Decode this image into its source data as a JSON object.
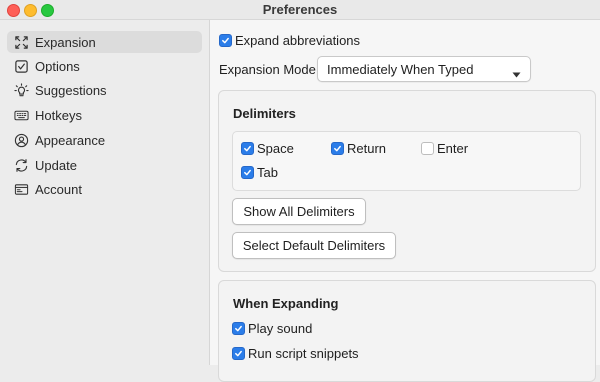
{
  "window": {
    "title": "Preferences"
  },
  "sidebar": {
    "items": [
      {
        "label": "Expansion",
        "icon": "expand-arrows-icon",
        "selected": true
      },
      {
        "label": "Options",
        "icon": "checkbox-icon",
        "selected": false
      },
      {
        "label": "Suggestions",
        "icon": "lightbulb-icon",
        "selected": false
      },
      {
        "label": "Hotkeys",
        "icon": "keyboard-icon",
        "selected": false
      },
      {
        "label": "Appearance",
        "icon": "person-circle-icon",
        "selected": false
      },
      {
        "label": "Update",
        "icon": "refresh-icon",
        "selected": false
      },
      {
        "label": "Account",
        "icon": "id-card-icon",
        "selected": false
      }
    ]
  },
  "expansion": {
    "expand_abbreviations": {
      "label": "Expand abbreviations",
      "checked": true
    },
    "mode": {
      "label": "Expansion Mode:",
      "value": "Immediately When Typed"
    }
  },
  "delimiters": {
    "title": "Delimiters",
    "options": [
      {
        "label": "Space",
        "checked": true
      },
      {
        "label": "Return",
        "checked": true
      },
      {
        "label": "Enter",
        "checked": false
      },
      {
        "label": "Tab",
        "checked": true
      }
    ],
    "show_all_label": "Show All Delimiters",
    "select_default_label": "Select Default Delimiters"
  },
  "when_expanding": {
    "title": "When Expanding",
    "options": [
      {
        "label": "Play sound",
        "checked": true
      },
      {
        "label": "Run script snippets",
        "checked": true
      }
    ]
  },
  "colors": {
    "accent": "#2b7de9",
    "selected_bg": "#dcdcdc"
  }
}
